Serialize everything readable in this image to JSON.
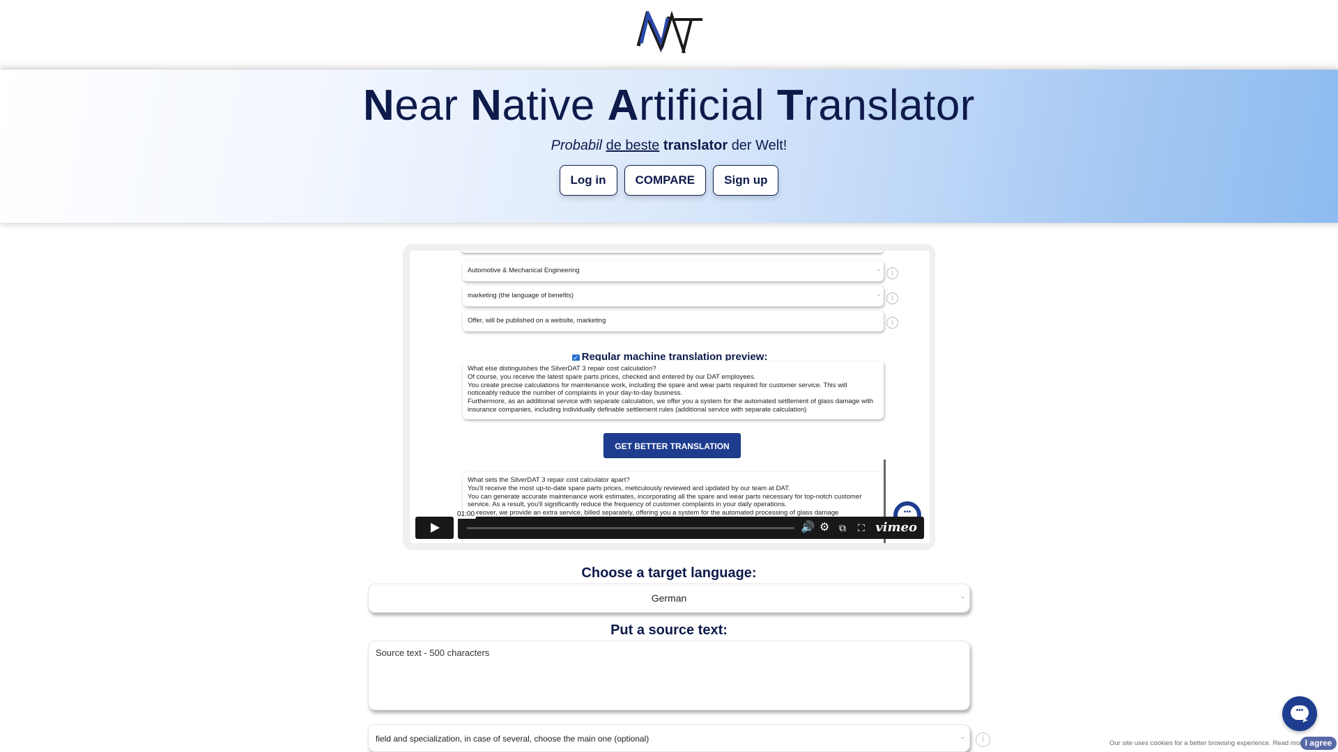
{
  "brand": {
    "logo_text": "NAT",
    "colors": {
      "primary_dark": "#0d1a4a",
      "accent_blue": "#1e3d8f",
      "logo_blue": "#2a47a8"
    }
  },
  "hero": {
    "title_parts": [
      {
        "bold": "N",
        "rest": "ear"
      },
      {
        "bold": "N",
        "rest": "ative"
      },
      {
        "bold": "A",
        "rest": "rtificial"
      },
      {
        "bold": "T",
        "rest": "ranslator"
      }
    ],
    "tagline": {
      "italic": "Probabil",
      "underlined": "de beste",
      "bold": "translator",
      "rest": "der Welt!"
    },
    "buttons": {
      "login": "Log in",
      "compare": "COMPARE",
      "signup": "Sign up"
    }
  },
  "video": {
    "fields": [
      {
        "value": "Automotive & Mechanical Engineering",
        "type": "select"
      },
      {
        "value": "marketing (the language of benefits)",
        "type": "select"
      },
      {
        "value": "Offer, will be published on a website, marketing",
        "type": "input"
      }
    ],
    "checkbox_label": "Regular machine translation preview:",
    "preview_text": [
      "What else distinguishes the SilverDAT 3 repair cost calculation?",
      "Of course, you receive the latest spare parts prices, checked and entered by our DAT employees.",
      "You create precise calculations for maintenance work, including the spare and wear parts required for customer service. This will noticeably reduce the number of complaints in your day-to-day business.",
      "Furthermore, as an additional service with separate calculation, we offer you a system for the automated settlement of glass damage with insurance companies, including individually definable settlement rules (additional service with separate calculation)"
    ],
    "get_better_button": "GET BETTER TRANSLATION",
    "better_text": [
      "What sets the SilverDAT 3 repair cost calculator apart?",
      "You'll receive the most up-to-date spare parts prices, meticulously reviewed and updated by our team at DAT.",
      "You can generate accurate maintenance work estimates, incorporating all the spare and wear parts necessary for top-notch customer service. As a result, you'll significantly reduce the frequency of customer complaints in your daily operations.",
      "Moreover, we provide an extra service, billed separately, offering you a system for the automated processing of glass damage"
    ],
    "player": {
      "time_label": "01:00",
      "progress_fraction": 0.0,
      "controls": [
        "volume-icon",
        "settings-icon",
        "pip-icon",
        "fullscreen-icon"
      ],
      "brand": "vimeo"
    }
  },
  "form": {
    "target_language_label": "Choose a target language:",
    "target_language_value": "German",
    "source_text_label": "Put a source text:",
    "source_text_placeholder": "Source text - 500 characters",
    "source_text_value": "",
    "field_select_value": "field and specialization, in case of several, choose the main one (optional)"
  },
  "cookie": {
    "text": "Our site uses cookies for a better browsing experience. Read more",
    "agree_button": "I agree"
  },
  "chat": {
    "icon": "chat-bubble-icon",
    "dots": "•••"
  }
}
